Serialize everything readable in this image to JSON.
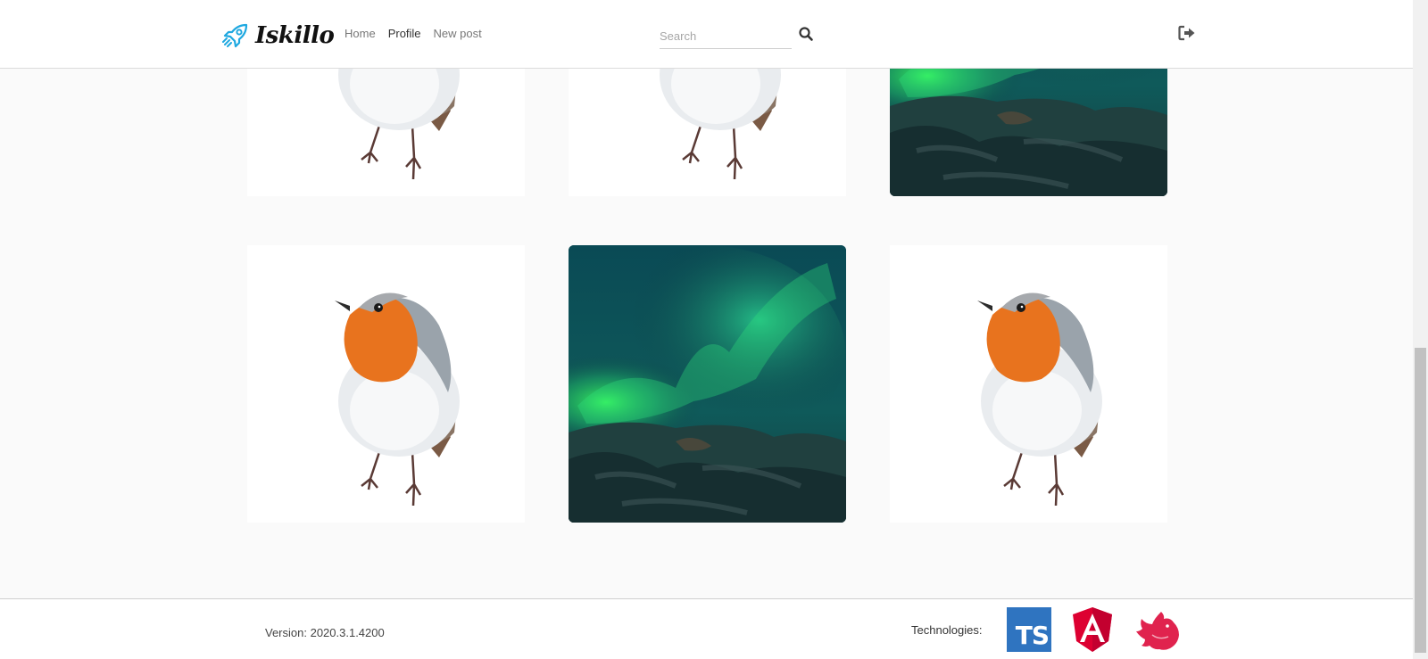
{
  "app": {
    "brand_name": "Iskillo",
    "accent_color": "#1ea8e0"
  },
  "nav": {
    "items": [
      {
        "label": "Home",
        "active": false
      },
      {
        "label": "Profile",
        "active": true
      },
      {
        "label": "New post",
        "active": false
      }
    ]
  },
  "search": {
    "placeholder": "Search",
    "value": "",
    "icon": "search-icon"
  },
  "header": {
    "logout_icon": "sign-out-icon"
  },
  "posts": [
    {
      "image": "robin"
    },
    {
      "image": "robin"
    },
    {
      "image": "aurora"
    },
    {
      "image": "robin"
    },
    {
      "image": "aurora"
    },
    {
      "image": "robin"
    }
  ],
  "footer": {
    "version_text": "Version: 2020.3.1.4200",
    "technologies_label": "Technologies:",
    "technologies": [
      {
        "name": "typescript-logo",
        "badge_text": "TS",
        "color": "#2f74c0"
      },
      {
        "name": "angular-logo",
        "badge_text": "A",
        "color": "#dd0031"
      },
      {
        "name": "nestjs-logo",
        "color": "#e0234e"
      }
    ]
  }
}
